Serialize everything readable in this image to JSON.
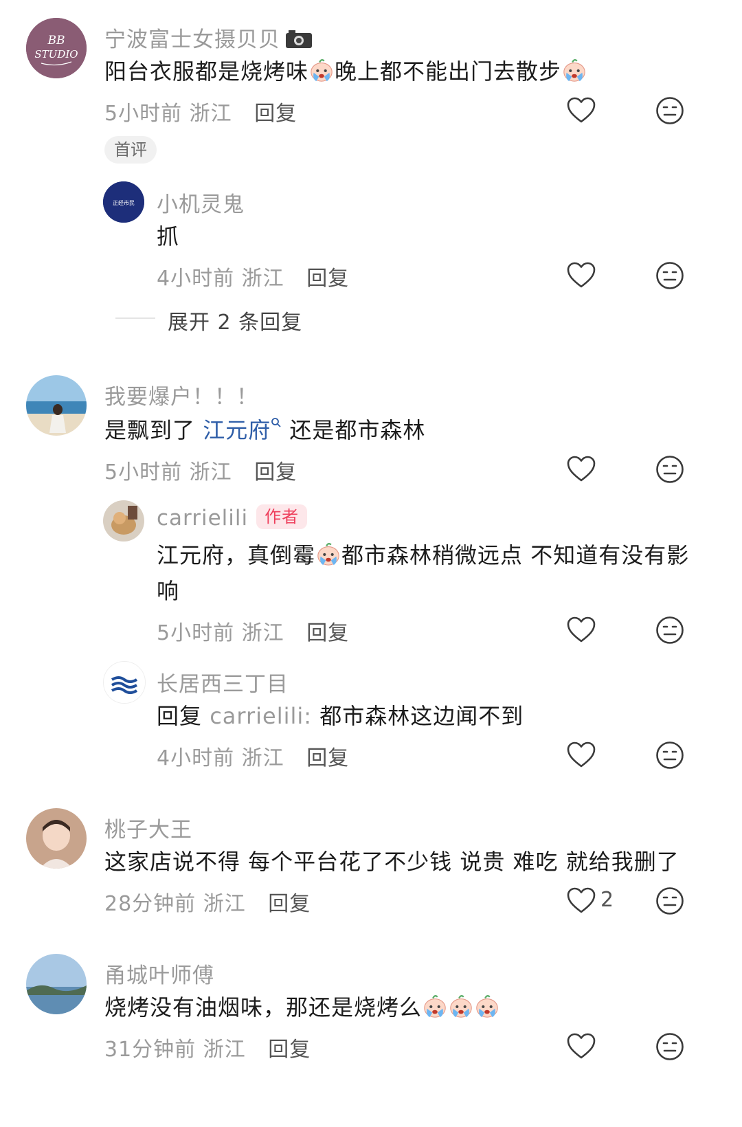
{
  "comments": [
    {
      "username": "宁波富士女摄贝贝",
      "text_a": "阳台衣服都是烧烤味",
      "text_b": "晚上都不能出门去散步",
      "time": "5小时前",
      "location": "浙江",
      "reply": "回复",
      "badge": "首评",
      "avatar_text": "BB STUDIO"
    },
    {
      "username": "小机灵鬼",
      "text": "抓",
      "time": "4小时前",
      "location": "浙江",
      "reply": "回复",
      "avatar_text": "正经市民"
    },
    {
      "expand_label": "展开 2 条回复"
    },
    {
      "username": "我要爆户！！！",
      "text_a": "是飘到了 ",
      "link": "江元府",
      "text_b": " 还是都市森林",
      "time": "5小时前",
      "location": "浙江",
      "reply": "回复"
    },
    {
      "username": "carrielili",
      "author_tag": "作者",
      "text_a": "江元府，真倒霉",
      "text_b": "都市森林稍微远点 不知道有没有影",
      "text_line2": "响",
      "time": "5小时前",
      "location": "浙江",
      "reply": "回复"
    },
    {
      "username": "长居西三丁目",
      "reply_prefix": "回复 ",
      "reply_to": "carrielili:",
      "text": " 都市森林这边闻不到",
      "time": "4小时前",
      "location": "浙江",
      "reply": "回复"
    },
    {
      "username": "桃子大王",
      "text": "这家店说不得 每个平台花了不少钱 说贵 难吃 就给我删了",
      "time": "28分钟前",
      "location": "浙江",
      "reply": "回复",
      "likes": "2"
    },
    {
      "username": "甬城叶师傅",
      "text": "烧烤没有油烟味，那还是烧烤么",
      "time": "31分钟前",
      "location": "浙江",
      "reply": "回复"
    }
  ],
  "colors": {
    "link": "#2f5ea8",
    "author_tag_bg": "#fde7ea",
    "author_tag_text": "#ee3f5c"
  },
  "icons": [
    "heart-outline-icon",
    "neutral-face-icon",
    "crying-emoji-icon",
    "camera-icon",
    "search-icon"
  ]
}
